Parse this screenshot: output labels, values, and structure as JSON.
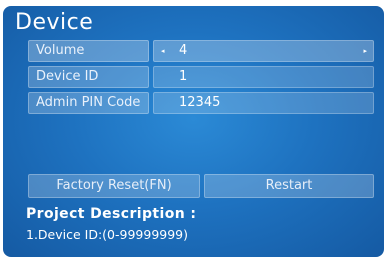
{
  "page_title": "Device",
  "settings": [
    {
      "label": "Volume",
      "value": "4",
      "left_arrow": "◂",
      "right_arrow": "▸"
    },
    {
      "label": "Device ID",
      "value": "1"
    },
    {
      "label": "Admin PIN Code",
      "value": "12345"
    }
  ],
  "buttons": {
    "factory_reset": "Factory Reset(FN)",
    "restart": "Restart"
  },
  "description": {
    "title": "Project Description :",
    "line1": "1.Device ID:(0-99999999)"
  }
}
